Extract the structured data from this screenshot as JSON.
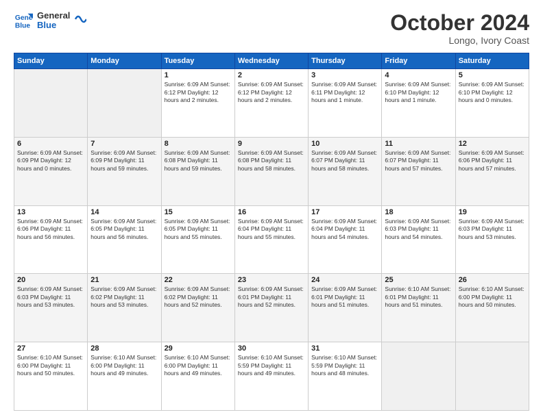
{
  "header": {
    "logo_line1": "General",
    "logo_line2": "Blue",
    "month_title": "October 2024",
    "location": "Longo, Ivory Coast"
  },
  "days_of_week": [
    "Sunday",
    "Monday",
    "Tuesday",
    "Wednesday",
    "Thursday",
    "Friday",
    "Saturday"
  ],
  "weeks": [
    [
      {
        "day": "",
        "detail": ""
      },
      {
        "day": "",
        "detail": ""
      },
      {
        "day": "1",
        "detail": "Sunrise: 6:09 AM\nSunset: 6:12 PM\nDaylight: 12 hours\nand 2 minutes."
      },
      {
        "day": "2",
        "detail": "Sunrise: 6:09 AM\nSunset: 6:12 PM\nDaylight: 12 hours\nand 2 minutes."
      },
      {
        "day": "3",
        "detail": "Sunrise: 6:09 AM\nSunset: 6:11 PM\nDaylight: 12 hours\nand 1 minute."
      },
      {
        "day": "4",
        "detail": "Sunrise: 6:09 AM\nSunset: 6:10 PM\nDaylight: 12 hours\nand 1 minute."
      },
      {
        "day": "5",
        "detail": "Sunrise: 6:09 AM\nSunset: 6:10 PM\nDaylight: 12 hours\nand 0 minutes."
      }
    ],
    [
      {
        "day": "6",
        "detail": "Sunrise: 6:09 AM\nSunset: 6:09 PM\nDaylight: 12 hours\nand 0 minutes."
      },
      {
        "day": "7",
        "detail": "Sunrise: 6:09 AM\nSunset: 6:09 PM\nDaylight: 11 hours\nand 59 minutes."
      },
      {
        "day": "8",
        "detail": "Sunrise: 6:09 AM\nSunset: 6:08 PM\nDaylight: 11 hours\nand 59 minutes."
      },
      {
        "day": "9",
        "detail": "Sunrise: 6:09 AM\nSunset: 6:08 PM\nDaylight: 11 hours\nand 58 minutes."
      },
      {
        "day": "10",
        "detail": "Sunrise: 6:09 AM\nSunset: 6:07 PM\nDaylight: 11 hours\nand 58 minutes."
      },
      {
        "day": "11",
        "detail": "Sunrise: 6:09 AM\nSunset: 6:07 PM\nDaylight: 11 hours\nand 57 minutes."
      },
      {
        "day": "12",
        "detail": "Sunrise: 6:09 AM\nSunset: 6:06 PM\nDaylight: 11 hours\nand 57 minutes."
      }
    ],
    [
      {
        "day": "13",
        "detail": "Sunrise: 6:09 AM\nSunset: 6:06 PM\nDaylight: 11 hours\nand 56 minutes."
      },
      {
        "day": "14",
        "detail": "Sunrise: 6:09 AM\nSunset: 6:05 PM\nDaylight: 11 hours\nand 56 minutes."
      },
      {
        "day": "15",
        "detail": "Sunrise: 6:09 AM\nSunset: 6:05 PM\nDaylight: 11 hours\nand 55 minutes."
      },
      {
        "day": "16",
        "detail": "Sunrise: 6:09 AM\nSunset: 6:04 PM\nDaylight: 11 hours\nand 55 minutes."
      },
      {
        "day": "17",
        "detail": "Sunrise: 6:09 AM\nSunset: 6:04 PM\nDaylight: 11 hours\nand 54 minutes."
      },
      {
        "day": "18",
        "detail": "Sunrise: 6:09 AM\nSunset: 6:03 PM\nDaylight: 11 hours\nand 54 minutes."
      },
      {
        "day": "19",
        "detail": "Sunrise: 6:09 AM\nSunset: 6:03 PM\nDaylight: 11 hours\nand 53 minutes."
      }
    ],
    [
      {
        "day": "20",
        "detail": "Sunrise: 6:09 AM\nSunset: 6:03 PM\nDaylight: 11 hours\nand 53 minutes."
      },
      {
        "day": "21",
        "detail": "Sunrise: 6:09 AM\nSunset: 6:02 PM\nDaylight: 11 hours\nand 53 minutes."
      },
      {
        "day": "22",
        "detail": "Sunrise: 6:09 AM\nSunset: 6:02 PM\nDaylight: 11 hours\nand 52 minutes."
      },
      {
        "day": "23",
        "detail": "Sunrise: 6:09 AM\nSunset: 6:01 PM\nDaylight: 11 hours\nand 52 minutes."
      },
      {
        "day": "24",
        "detail": "Sunrise: 6:09 AM\nSunset: 6:01 PM\nDaylight: 11 hours\nand 51 minutes."
      },
      {
        "day": "25",
        "detail": "Sunrise: 6:10 AM\nSunset: 6:01 PM\nDaylight: 11 hours\nand 51 minutes."
      },
      {
        "day": "26",
        "detail": "Sunrise: 6:10 AM\nSunset: 6:00 PM\nDaylight: 11 hours\nand 50 minutes."
      }
    ],
    [
      {
        "day": "27",
        "detail": "Sunrise: 6:10 AM\nSunset: 6:00 PM\nDaylight: 11 hours\nand 50 minutes."
      },
      {
        "day": "28",
        "detail": "Sunrise: 6:10 AM\nSunset: 6:00 PM\nDaylight: 11 hours\nand 49 minutes."
      },
      {
        "day": "29",
        "detail": "Sunrise: 6:10 AM\nSunset: 6:00 PM\nDaylight: 11 hours\nand 49 minutes."
      },
      {
        "day": "30",
        "detail": "Sunrise: 6:10 AM\nSunset: 5:59 PM\nDaylight: 11 hours\nand 49 minutes."
      },
      {
        "day": "31",
        "detail": "Sunrise: 6:10 AM\nSunset: 5:59 PM\nDaylight: 11 hours\nand 48 minutes."
      },
      {
        "day": "",
        "detail": ""
      },
      {
        "day": "",
        "detail": ""
      }
    ]
  ]
}
